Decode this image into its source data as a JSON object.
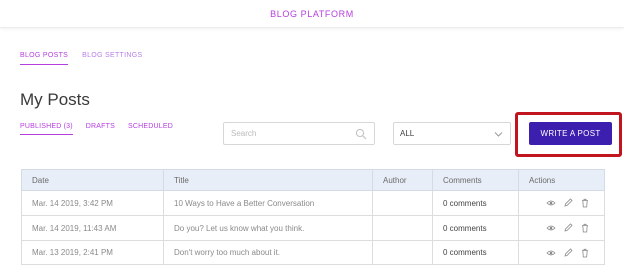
{
  "header": {
    "app_title": "BLOG PLATFORM"
  },
  "section_tabs": [
    {
      "label": "BLOG POSTS",
      "active": true
    },
    {
      "label": "BLOG SETTINGS",
      "active": false
    }
  ],
  "page": {
    "title": "My Posts"
  },
  "post_tabs": [
    {
      "label": "PUBLISHED (3)",
      "active": true
    },
    {
      "label": "DRAFTS",
      "active": false
    },
    {
      "label": "SCHEDULED",
      "active": false
    }
  ],
  "search": {
    "placeholder": "Search",
    "value": "",
    "icon": "search-icon"
  },
  "filter": {
    "selected": "ALL",
    "icon": "chevron-down-icon"
  },
  "write_button": {
    "label": "WRITE A POST",
    "color": "#3d1fb0"
  },
  "highlight_color": "#c0141f",
  "accent_color": "#b63ee0",
  "table": {
    "columns": [
      "Date",
      "Title",
      "Author",
      "Comments",
      "Actions"
    ],
    "rows": [
      {
        "date": "Mar. 14 2019, 3:42 PM",
        "title": "10 Ways to Have a Better Conversation",
        "author": "",
        "comments": "0 comments"
      },
      {
        "date": "Mar. 14 2019, 11:43 AM",
        "title": "Do you? Let us know what you think.",
        "author": "",
        "comments": "0 comments"
      },
      {
        "date": "Mar. 13 2019, 2:41 PM",
        "title": "Don't worry too much about it.",
        "author": "",
        "comments": "0 comments"
      }
    ],
    "action_icons": [
      "eye-icon",
      "pencil-icon",
      "trash-icon"
    ]
  }
}
